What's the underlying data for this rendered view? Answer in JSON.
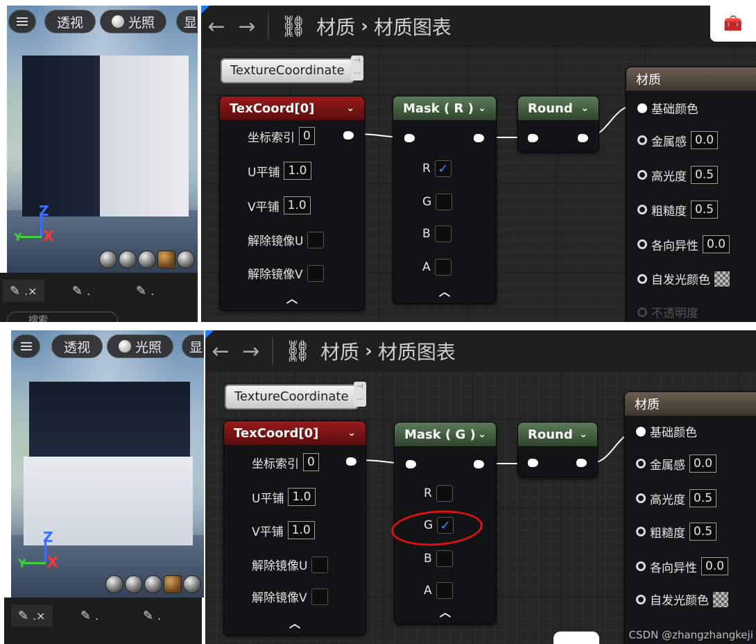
{
  "viewport": {
    "perspective_label": "透视",
    "lighting_label": "光照",
    "show_label": "显",
    "axis": {
      "z": "Z",
      "x": "X",
      "y": "Y"
    },
    "tabs": [
      ".×",
      ".",
      "."
    ],
    "search_placeholder": "搜索"
  },
  "graph": {
    "breadcrumb": [
      "材质",
      "材质图表"
    ],
    "comment_label": "TextureCoordinate",
    "texcoord": {
      "title": "TexCoord[0]",
      "rows": [
        {
          "label": "坐标索引",
          "value": "0"
        },
        {
          "label": "U平铺",
          "value": "1.0"
        },
        {
          "label": "V平铺",
          "value": "1.0"
        },
        {
          "label": "解除镜像U"
        },
        {
          "label": "解除镜像V"
        }
      ]
    },
    "round_title": "Round",
    "channel_labels": [
      "R",
      "G",
      "B",
      "A"
    ],
    "material": {
      "title": "材质",
      "rows": [
        {
          "label": "基础颜色"
        },
        {
          "label": "金属感",
          "value": "0.0"
        },
        {
          "label": "高光度",
          "value": "0.5"
        },
        {
          "label": "粗糙度",
          "value": "0.5"
        },
        {
          "label": "各向异性",
          "value": "0.0"
        },
        {
          "label": "自发光颜色"
        },
        {
          "label": "不透明度"
        }
      ]
    }
  },
  "panels": [
    {
      "mask_title": "Mask ( R )",
      "checked": [
        true,
        false,
        false,
        false
      ]
    },
    {
      "mask_title": "Mask ( G )",
      "checked": [
        false,
        true,
        false,
        false
      ]
    }
  ],
  "watermark": "CSDN @zhangzhangkeji",
  "colors": {
    "accent_blue": "#3d90ff",
    "title_red": "#9a1b1b",
    "title_green": "#5c7c58",
    "highlight": "#e01010"
  }
}
